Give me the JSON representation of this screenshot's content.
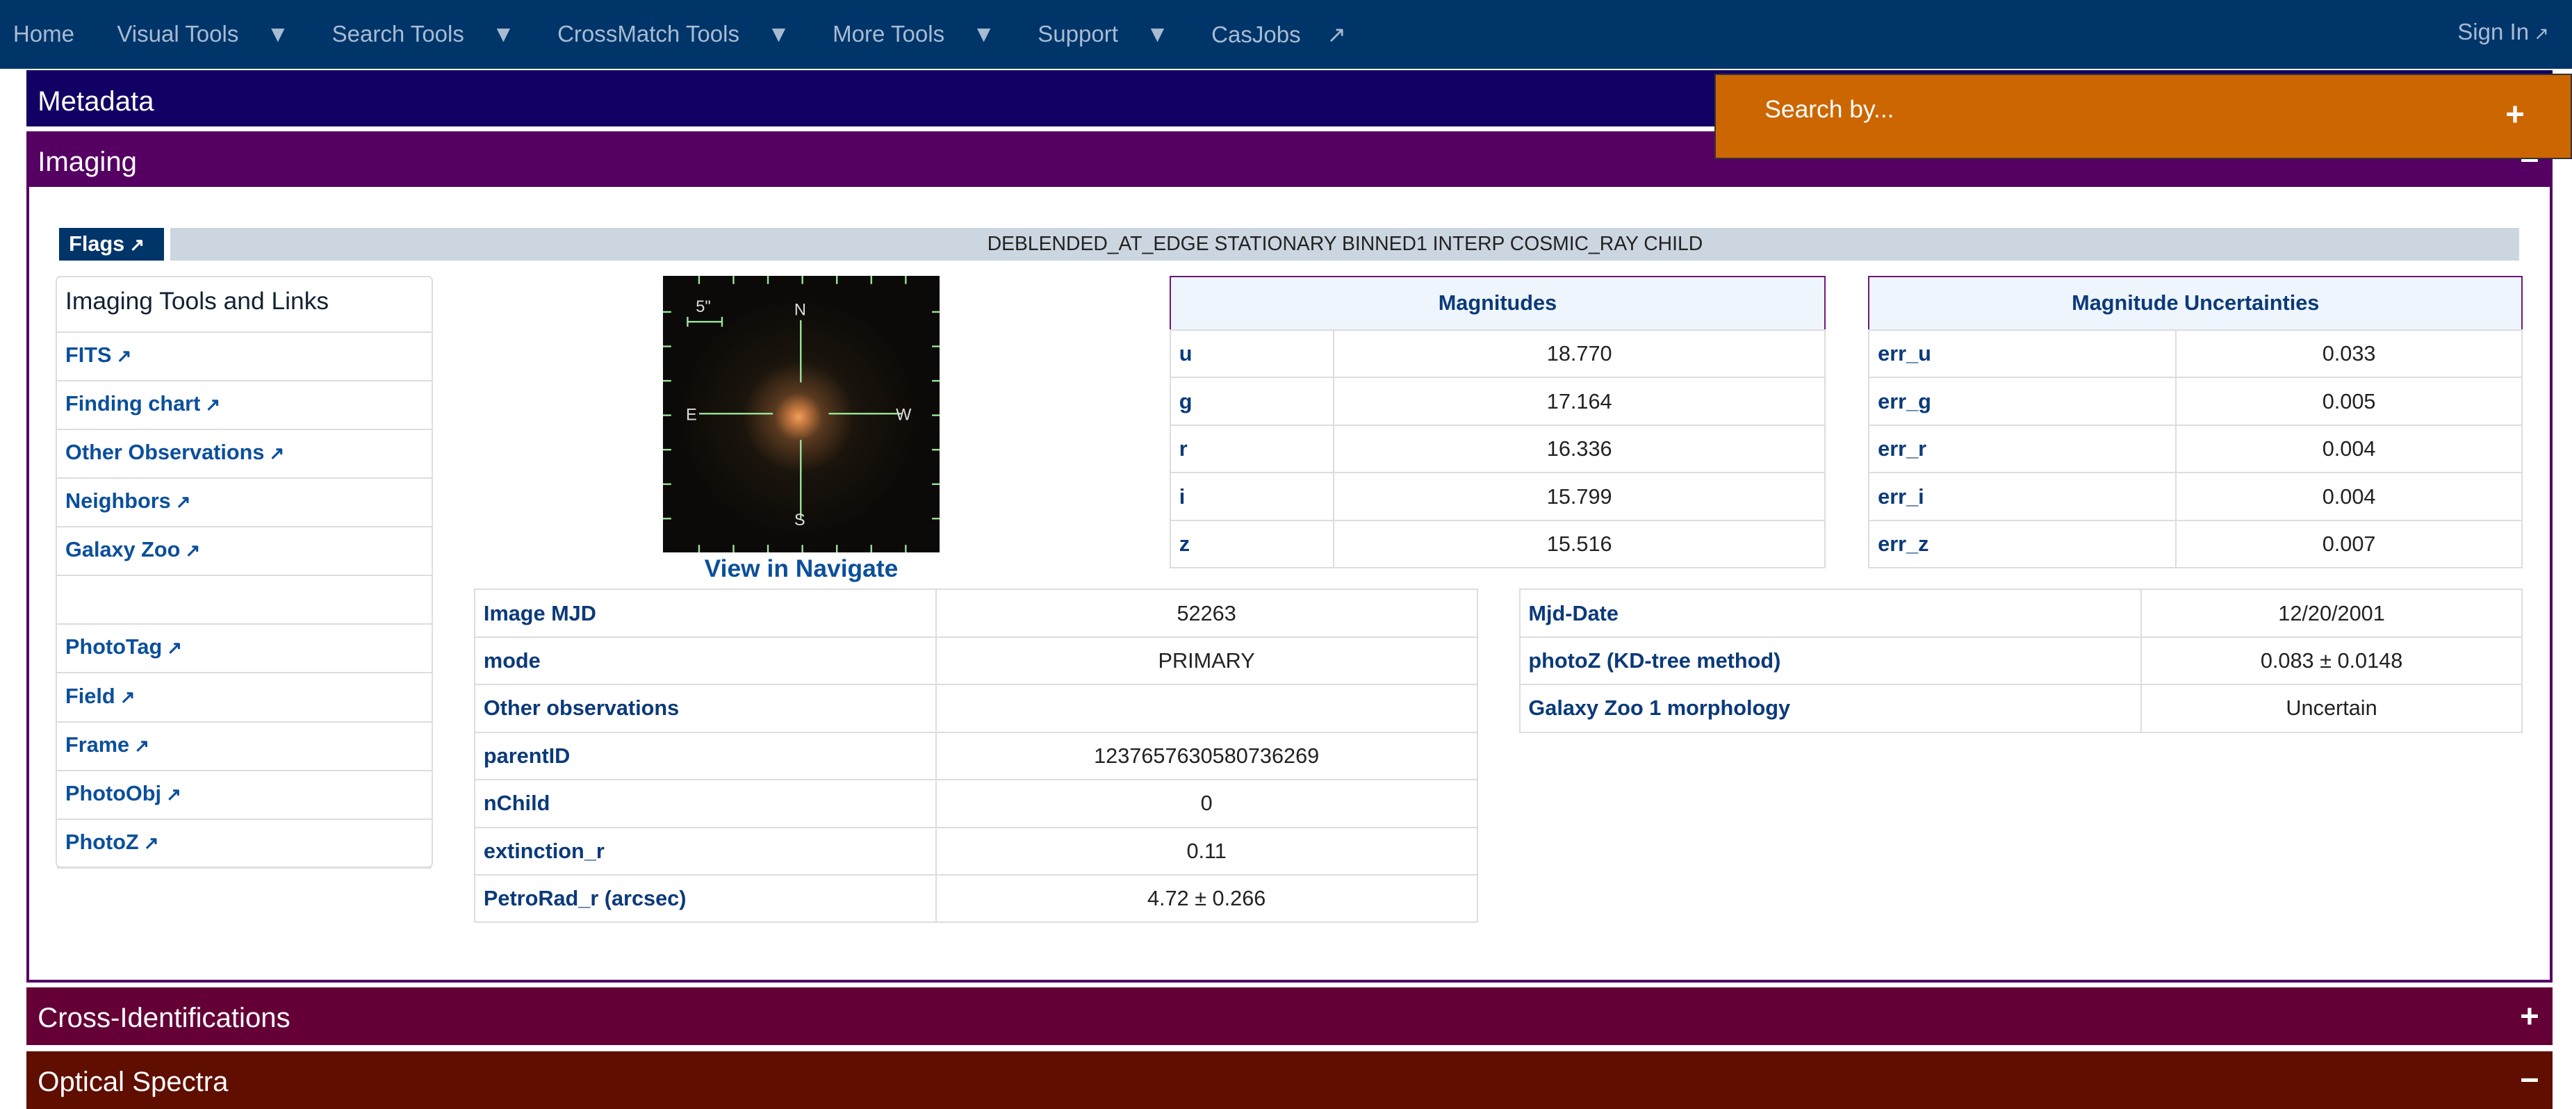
{
  "nav": {
    "items": [
      {
        "label": "Home",
        "dropdown": false
      },
      {
        "label": "Visual Tools",
        "dropdown": true
      },
      {
        "label": "Search Tools",
        "dropdown": true
      },
      {
        "label": "CrossMatch Tools",
        "dropdown": true
      },
      {
        "label": "More Tools",
        "dropdown": true
      },
      {
        "label": "Support",
        "dropdown": true
      },
      {
        "label": "CasJobs",
        "external": true
      }
    ],
    "sign_in": "Sign In"
  },
  "sections": {
    "metadata": "Metadata",
    "imaging": "Imaging",
    "cross": "Cross-Identifications",
    "spectra": "Optical Spectra"
  },
  "search": {
    "label": "Search by...",
    "toggle": "+"
  },
  "toggles": {
    "imaging": "−",
    "cross": "+",
    "spectra": "−"
  },
  "flags": {
    "label": "Flags",
    "value": "DEBLENDED_AT_EDGE STATIONARY BINNED1 INTERP COSMIC_RAY CHILD"
  },
  "tools": {
    "title": "Imaging Tools and Links",
    "items": [
      "FITS",
      "Finding chart",
      "Other Observations",
      "Neighbors",
      "Galaxy Zoo",
      "",
      "PhotoTag",
      "Field",
      "Frame",
      "PhotoObj",
      "PhotoZ"
    ]
  },
  "image": {
    "scale": "5\"",
    "n": "N",
    "s": "S",
    "e": "E",
    "w": "W",
    "link": "View in Navigate"
  },
  "magnitudes": {
    "header": "Magnitudes",
    "rows": [
      [
        "u",
        "18.770"
      ],
      [
        "g",
        "17.164"
      ],
      [
        "r",
        "16.336"
      ],
      [
        "i",
        "15.799"
      ],
      [
        "z",
        "15.516"
      ]
    ]
  },
  "uncertainties": {
    "header": "Magnitude Uncertainties",
    "rows": [
      [
        "err_u",
        "0.033"
      ],
      [
        "err_g",
        "0.005"
      ],
      [
        "err_r",
        "0.004"
      ],
      [
        "err_i",
        "0.004"
      ],
      [
        "err_z",
        "0.007"
      ]
    ]
  },
  "props": {
    "rows": [
      [
        "Image MJD",
        "52263"
      ],
      [
        "mode",
        "PRIMARY"
      ],
      [
        "Other observations",
        ""
      ],
      [
        "parentID",
        "1237657630580736269"
      ],
      [
        "nChild",
        "0"
      ],
      [
        "extinction_r",
        "0.11"
      ],
      [
        "PetroRad_r (arcsec)",
        "4.72 ± 0.266"
      ]
    ]
  },
  "dates": {
    "rows": [
      [
        "Mjd-Date",
        "12/20/2001"
      ],
      [
        "photoZ (KD-tree method)",
        "0.083 ± 0.0148"
      ],
      [
        "Galaxy Zoo 1 morphology",
        "Uncertain"
      ]
    ]
  },
  "colors": {
    "navbar": "#00356a",
    "metadata": "#120064",
    "imaging": "#550062",
    "cross": "#650036",
    "spectra": "#600e00",
    "search": "#cc6600"
  }
}
